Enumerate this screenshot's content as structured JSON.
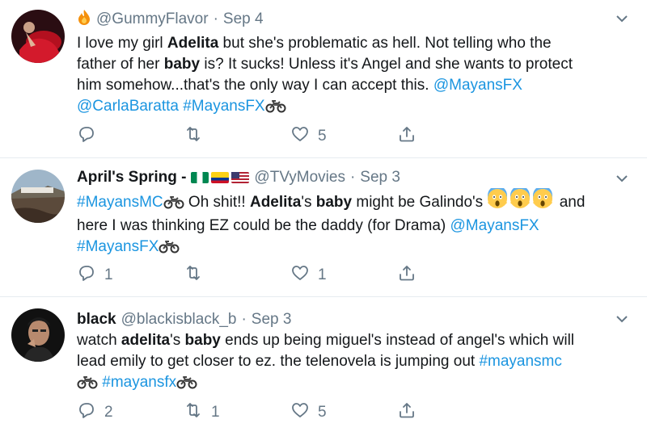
{
  "tweets": [
    {
      "display_name": "",
      "handle": "@GummyFlavor",
      "date": "Sep 4",
      "emoji_name": "fire-emoji",
      "lines": [
        [
          {
            "t": "I love my girl "
          },
          {
            "t": "Adelita",
            "s": "b"
          },
          {
            "t": " but she's problematic as hell. Not telling who the"
          }
        ],
        [
          {
            "t": "father of her "
          },
          {
            "t": "baby",
            "s": "b"
          },
          {
            "t": " is? It sucks! Unless it's Angel and she wants to protect"
          }
        ],
        [
          {
            "t": "him somehow...that's the only way I can accept this. "
          },
          {
            "t": "@MayansFX",
            "s": "link"
          }
        ],
        [
          {
            "t": "@CarlaBaratta",
            "s": "link"
          },
          {
            "t": " "
          },
          {
            "t": "#MayansFX",
            "s": "link"
          },
          {
            "t": "moto",
            "s": "moto"
          }
        ]
      ],
      "reply_count": "",
      "retweet_count": "",
      "like_count": "5"
    },
    {
      "display_name": "April's Spring -",
      "handle": "@TVyMovies",
      "date": "Sep 3",
      "flags": [
        "nigeria-flag",
        "colombia-flag",
        "usa-flag"
      ],
      "lines": [
        [
          {
            "t": "#MayansMC",
            "s": "link"
          },
          {
            "t": "moto",
            "s": "moto"
          },
          {
            "t": " Oh shit!! "
          },
          {
            "t": "Adelita",
            "s": "b"
          },
          {
            "t": "'s "
          },
          {
            "t": "baby",
            "s": "b"
          },
          {
            "t": " might be Galindo's "
          },
          {
            "t": "scream",
            "s": "scream"
          },
          {
            "t": " and"
          }
        ],
        [
          {
            "t": "here I was thinking EZ could be the daddy (for Drama) "
          },
          {
            "t": "@MayansFX",
            "s": "link"
          }
        ],
        [
          {
            "t": "#MayansFX",
            "s": "link"
          },
          {
            "t": "moto",
            "s": "moto"
          }
        ]
      ],
      "reply_count": "1",
      "retweet_count": "",
      "like_count": "1"
    },
    {
      "display_name": "black",
      "handle": "@blackisblack_b",
      "date": "Sep 3",
      "lines": [
        [
          {
            "t": "watch "
          },
          {
            "t": "adelita",
            "s": "b"
          },
          {
            "t": "'s "
          },
          {
            "t": "baby",
            "s": "b"
          },
          {
            "t": " ends up being miguel's instead of angel's which will"
          }
        ],
        [
          {
            "t": "lead emily to get closer to ez. the telenovela is jumping out "
          },
          {
            "t": "#mayansmc",
            "s": "link"
          }
        ],
        [
          {
            "t": "moto",
            "s": "moto"
          },
          {
            "t": " "
          },
          {
            "t": "#mayansfx",
            "s": "link"
          },
          {
            "t": "moto",
            "s": "moto"
          }
        ]
      ],
      "reply_count": "2",
      "retweet_count": "1",
      "like_count": "5"
    }
  ],
  "icons": {
    "reply": "reply-icon",
    "retweet": "retweet-icon",
    "like": "heart-icon",
    "share": "share-icon",
    "more": "chevron-down-icon"
  },
  "colors": {
    "link": "#1b95e0",
    "muted": "#657786",
    "divider": "#e6ecf0"
  }
}
